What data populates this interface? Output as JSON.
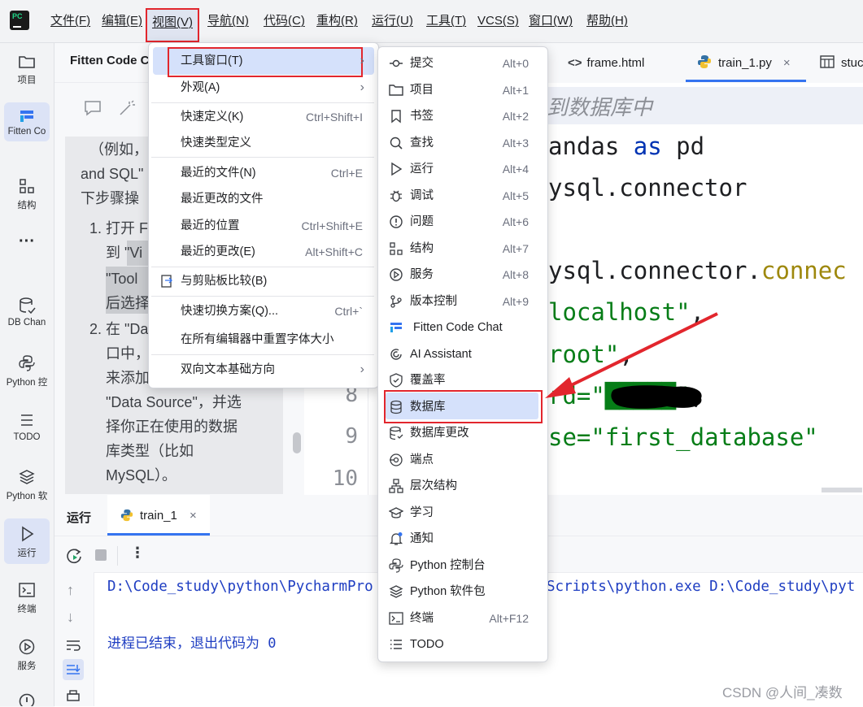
{
  "menubar": {
    "items": [
      {
        "label": "文件(F)"
      },
      {
        "label": "编辑(E)"
      },
      {
        "label": "视图(V)"
      },
      {
        "label": "导航(N)"
      },
      {
        "label": "代码(C)"
      },
      {
        "label": "重构(R)"
      },
      {
        "label": "运行(U)"
      },
      {
        "label": "工具(T)"
      },
      {
        "label": "VCS(S)"
      },
      {
        "label": "窗口(W)"
      },
      {
        "label": "帮助(H)"
      }
    ],
    "logo_text": "PC"
  },
  "left_toolbar": {
    "items": [
      {
        "label": "项目",
        "icon": "folder-icon"
      },
      {
        "label": "Fitten Co",
        "icon": "fitten-icon"
      },
      {
        "label": "结构",
        "icon": "structure-icon"
      },
      {
        "label": "···",
        "icon": "more-icon"
      },
      {
        "label": "DB Chan",
        "icon": "db-changes-icon"
      },
      {
        "label": "Python 控",
        "icon": "python-console-icon"
      },
      {
        "label": "TODO",
        "icon": "todo-icon"
      },
      {
        "label": "Python 软",
        "icon": "python-packages-icon"
      },
      {
        "label": "运行",
        "icon": "run-icon"
      },
      {
        "label": "终端",
        "icon": "terminal-icon"
      },
      {
        "label": "服务",
        "icon": "services-icon"
      }
    ]
  },
  "chat_panel": {
    "title": "Fitten Code C",
    "lines": [
      "（例如，",
      "and SQL\"",
      "下步骤操",
      "1. 打开 F",
      "到 \"Vi",
      "\"Tool",
      "后选择",
      "2. 在 \"Da",
      "口中，",
      "来添加",
      "\"Data Source\"，并选",
      "择你正在使用的数据",
      "库类型（比如",
      "MySQL）。"
    ]
  },
  "editor": {
    "tabs": [
      {
        "label": "frame.html",
        "icon": "html-icon"
      },
      {
        "label": "train_1.py",
        "icon": "python-icon",
        "close": "×"
      },
      {
        "label": "stuc",
        "icon": "table-icon"
      }
    ],
    "comment": "到数据库中",
    "line_numbers": [
      "8",
      "9",
      "10"
    ],
    "code_lines": [
      {
        "plain": "andas ",
        "kw": "as",
        "rest": " pd"
      },
      {
        "plain": "ysql.connector"
      },
      {
        "plain": ""
      },
      {
        "plain": "ysql.connector.",
        "fn": "connec"
      },
      {
        "str": "localhost\"",
        "rest": ","
      },
      {
        "str": "root\"",
        "rest": ","
      },
      {
        "plain": "rd=",
        "str": "\"█████\"",
        "rest": ","
      },
      {
        "plain": "se=",
        "str": "\"first_database\""
      }
    ]
  },
  "run_panel": {
    "title": "运行",
    "tab": "train_1",
    "tab_close": "×",
    "command": "D:\\Code_study\\python\\PycharmPro",
    "command_tail": "Scripts\\python.exe D:\\Code_study\\pyt",
    "exit_message": "进程已结束，退出代码为 0"
  },
  "view_menu": {
    "items": [
      {
        "label": "工具窗口(T)",
        "arrow": "›"
      },
      {
        "label": "外观(A)",
        "arrow": "›"
      },
      {
        "label": "快速定义(K)",
        "shortcut": "Ctrl+Shift+I"
      },
      {
        "label": "快速类型定义"
      },
      {
        "label": "最近的文件(N)",
        "shortcut": "Ctrl+E"
      },
      {
        "label": "最近更改的文件"
      },
      {
        "label": "最近的位置",
        "shortcut": "Ctrl+Shift+E"
      },
      {
        "label": "最近的更改(E)",
        "shortcut": "Alt+Shift+C"
      },
      {
        "label": "与剪贴板比较(B)"
      },
      {
        "label": "快速切换方案(Q)...",
        "shortcut": "Ctrl+`"
      },
      {
        "label": "在所有编辑器中重置字体大小"
      },
      {
        "label": "双向文本基础方向",
        "arrow": "›"
      }
    ]
  },
  "tool_windows_menu": {
    "items": [
      {
        "label": "提交",
        "shortcut": "Alt+0",
        "icon": "commit-icon"
      },
      {
        "label": "项目",
        "shortcut": "Alt+1",
        "icon": "folder-icon"
      },
      {
        "label": "书签",
        "shortcut": "Alt+2",
        "icon": "bookmark-icon"
      },
      {
        "label": "查找",
        "shortcut": "Alt+3",
        "icon": "search-icon"
      },
      {
        "label": "运行",
        "shortcut": "Alt+4",
        "icon": "run-icon"
      },
      {
        "label": "调试",
        "shortcut": "Alt+5",
        "icon": "debug-icon"
      },
      {
        "label": "问题",
        "shortcut": "Alt+6",
        "icon": "problems-icon"
      },
      {
        "label": "结构",
        "shortcut": "Alt+7",
        "icon": "structure-icon"
      },
      {
        "label": "服务",
        "shortcut": "Alt+8",
        "icon": "services-icon"
      },
      {
        "label": "版本控制",
        "shortcut": "Alt+9",
        "icon": "vcs-icon"
      },
      {
        "label": "Fitten Code Chat",
        "icon": "fitten-icon"
      },
      {
        "label": "AI Assistant",
        "icon": "ai-icon"
      },
      {
        "label": "覆盖率",
        "icon": "coverage-icon"
      },
      {
        "label": "数据库",
        "icon": "database-icon"
      },
      {
        "label": "数据库更改",
        "icon": "db-changes-icon"
      },
      {
        "label": "端点",
        "icon": "endpoints-icon"
      },
      {
        "label": "层次结构",
        "icon": "hierarchy-icon"
      },
      {
        "label": "学习",
        "icon": "learn-icon"
      },
      {
        "label": "通知",
        "icon": "bell-icon"
      },
      {
        "label": "Python 控制台",
        "icon": "python-console-icon"
      },
      {
        "label": "Python 软件包",
        "icon": "python-packages-icon"
      },
      {
        "label": "终端",
        "shortcut": "Alt+F12",
        "icon": "terminal-icon"
      },
      {
        "label": "TODO",
        "icon": "todo-icon"
      }
    ]
  },
  "watermark": "CSDN @人间_凑数",
  "colors": {
    "highlight_box": "#e2262d",
    "selection": "#d5e1fb",
    "accent": "#3574f0"
  }
}
